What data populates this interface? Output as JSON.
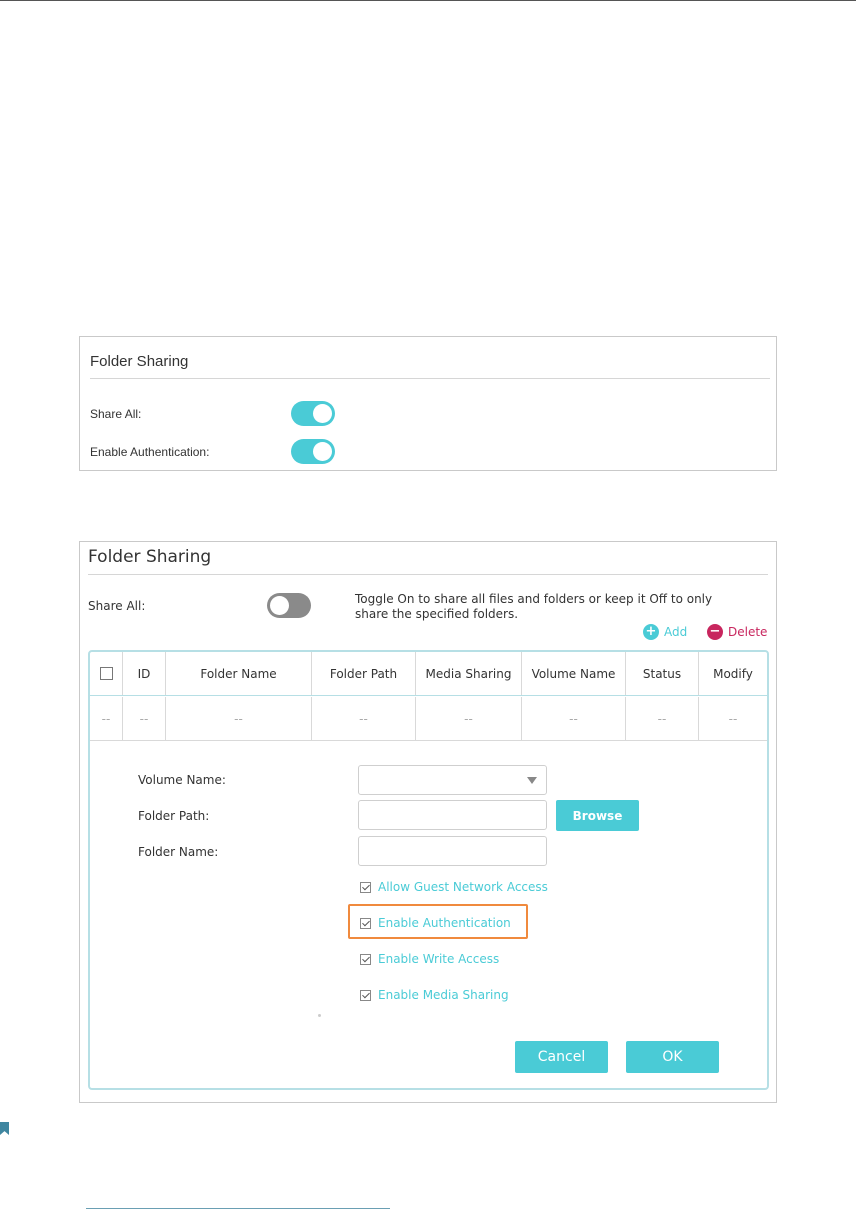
{
  "panel1": {
    "title": "Folder Sharing",
    "share_all_label": "Share All:",
    "enable_auth_label": "Enable Authentication:",
    "share_all_on": true,
    "enable_auth_on": true
  },
  "panel2": {
    "title": "Folder Sharing",
    "share_all_label": "Share All:",
    "share_all_on": false,
    "hint": "Toggle On to share all files and folders or keep it Off to only share the specified folders.",
    "add_label": "Add",
    "delete_label": "Delete",
    "table": {
      "columns": [
        "ID",
        "Folder Name",
        "Folder Path",
        "Media Sharing",
        "Volume Name",
        "Status",
        "Modify"
      ],
      "empty_row": [
        "--",
        "--",
        "--",
        "--",
        "--",
        "--",
        "--",
        "--"
      ]
    },
    "form": {
      "volume_name_label": "Volume Name:",
      "folder_path_label": "Folder Path:",
      "folder_name_label": "Folder Name:",
      "browse_label": "Browse",
      "checkboxes": [
        "Allow Guest Network Access",
        "Enable Authentication",
        "Enable Write Access",
        "Enable Media Sharing"
      ],
      "cancel_label": "Cancel",
      "ok_label": "OK"
    }
  },
  "colors": {
    "accent": "#4acbd6",
    "delete": "#c8265e",
    "highlight": "#f08a3e"
  }
}
